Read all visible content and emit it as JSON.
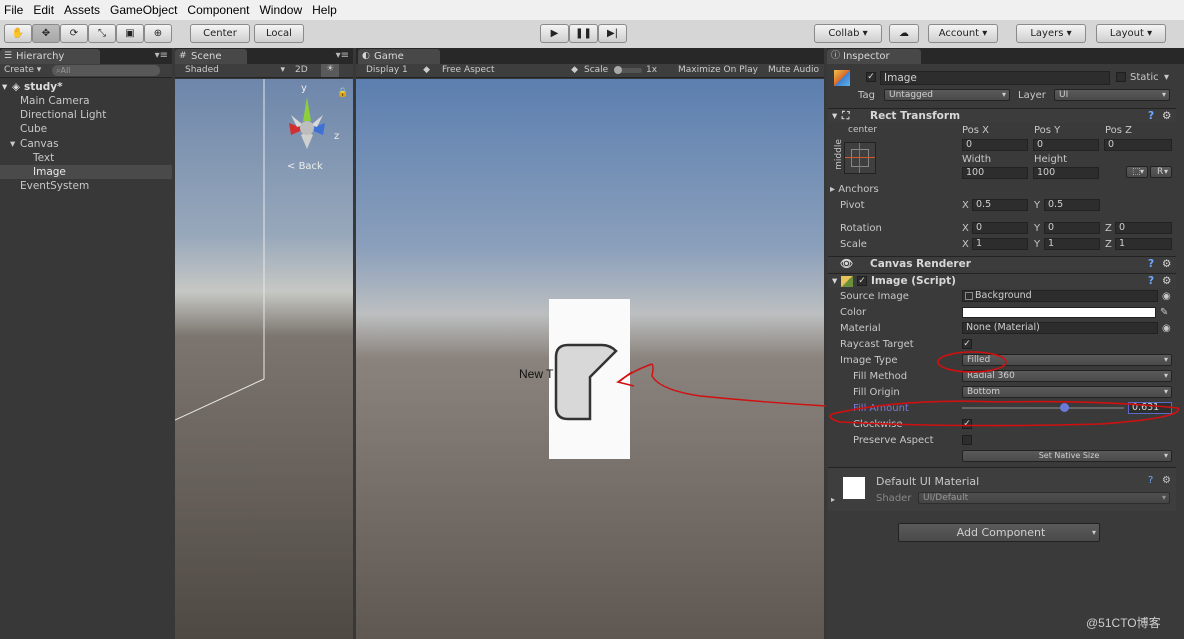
{
  "menu": [
    "File",
    "Edit",
    "Assets",
    "GameObject",
    "Component",
    "Window",
    "Help"
  ],
  "toolbar": {
    "center": "Center",
    "local": "Local",
    "collab": "Collab",
    "account": "Account",
    "layers": "Layers",
    "layout": "Layout"
  },
  "hierarchy": {
    "tab": "Hierarchy",
    "create": "Create",
    "search": "All",
    "scene_name": "study*",
    "items": [
      "Main Camera",
      "Directional Light",
      "Cube",
      "Canvas",
      "Text",
      "Image",
      "EventSystem"
    ]
  },
  "scene": {
    "tab": "Scene",
    "shading": "Shaded",
    "mode2d": "2D",
    "back": "Back",
    "axis_y": "y",
    "axis_z": "z"
  },
  "game": {
    "tab": "Game",
    "display": "Display 1",
    "aspect": "Free Aspect",
    "scale_label": "Scale",
    "scale_value": "1x",
    "maximize": "Maximize On Play",
    "mute": "Mute Audio",
    "new_text": "New T"
  },
  "inspector": {
    "tab": "Inspector",
    "object_name": "Image",
    "static": "Static",
    "tag_label": "Tag",
    "tag_value": "Untagged",
    "layer_label": "Layer",
    "layer_value": "UI",
    "rect": {
      "title": "Rect Transform",
      "anchor_h": "center",
      "anchor_v": "middle",
      "posx_label": "Pos X",
      "posy_label": "Pos Y",
      "posz_label": "Pos Z",
      "posx": "0",
      "posy": "0",
      "posz": "0",
      "width_label": "Width",
      "height_label": "Height",
      "width": "100",
      "height": "100",
      "r": "R",
      "anchors": "Anchors",
      "pivot": "Pivot",
      "pivot_x": "0.5",
      "pivot_y": "0.5",
      "rotation": "Rotation",
      "rot_x": "0",
      "rot_y": "0",
      "rot_z": "0",
      "scale": "Scale",
      "scale_x": "1",
      "scale_y": "1",
      "scale_z": "1",
      "x": "X",
      "y": "Y",
      "z": "Z"
    },
    "canvas_renderer": "Canvas Renderer",
    "image_script": {
      "title": "Image (Script)",
      "source_label": "Source Image",
      "source_value": "Background",
      "color_label": "Color",
      "material_label": "Material",
      "material_value": "None (Material)",
      "raycast_label": "Raycast Target",
      "type_label": "Image Type",
      "type_value": "Filled",
      "method_label": "Fill Method",
      "method_value": "Radial 360",
      "origin_label": "Fill Origin",
      "origin_value": "Bottom",
      "amount_label": "Fill Amount",
      "amount_value": "0.631",
      "amount": 0.631,
      "clockwise_label": "Clockwise",
      "preserve_label": "Preserve Aspect",
      "native_size": "Set Native Size"
    },
    "material": {
      "name": "Default UI Material",
      "shader_label": "Shader",
      "shader_value": "UI/Default"
    },
    "add_component": "Add Component"
  },
  "watermark": "@51CTO博客",
  "colors": {
    "annotation": "#d01010",
    "fill_label": "#7a7ad8"
  }
}
